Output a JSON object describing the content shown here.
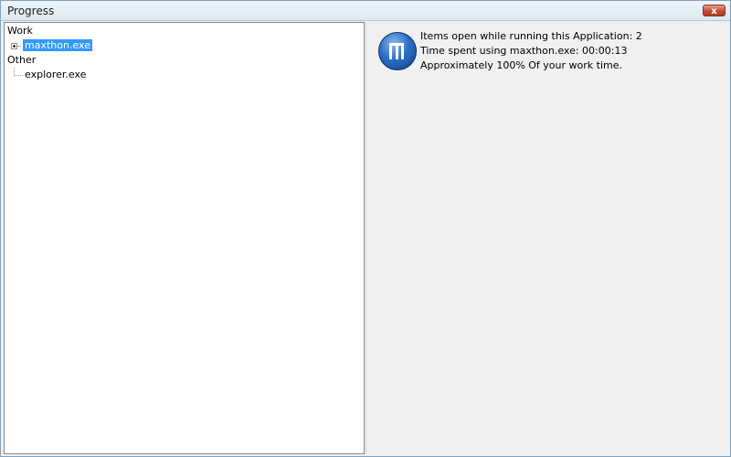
{
  "window": {
    "title": "Progress",
    "close_label": "x"
  },
  "tree": {
    "groups": [
      {
        "label": "Work",
        "items": [
          {
            "label": "maxthon.exe",
            "selected": true
          }
        ]
      },
      {
        "label": "Other",
        "items": [
          {
            "label": "explorer.exe",
            "selected": false
          }
        ]
      }
    ]
  },
  "details": {
    "icon": "maxthon-app-icon",
    "lines": [
      "Items open while running this Application: 2",
      "Time spent using maxthon.exe: 00:00:13",
      "Approximately 100% Of your work time."
    ]
  }
}
